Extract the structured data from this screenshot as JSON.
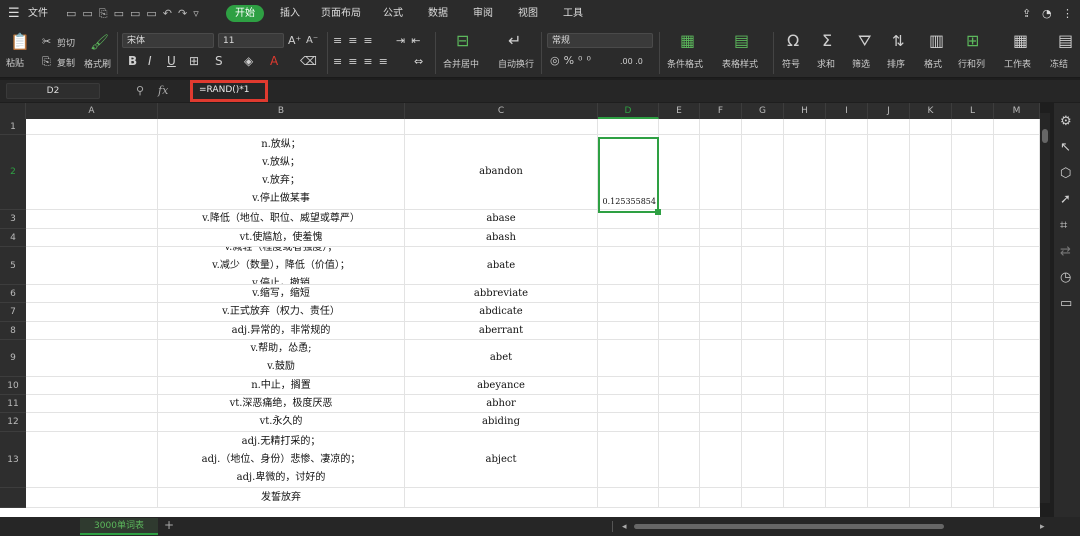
{
  "menubar": {
    "file": "文件",
    "tabs": [
      "开始",
      "插入",
      "页面布局",
      "公式",
      "数据",
      "审阅",
      "视图",
      "工具"
    ],
    "active_tab": "开始",
    "accent": "#2ea043"
  },
  "ribbon": {
    "cut": "剪切",
    "paste": "粘贴",
    "copy": "复制",
    "format_painter": "格式刷",
    "font_name": "宋体",
    "font_size": "11",
    "merge_center": "合并居中",
    "wrap_text": "自动换行",
    "number_format": "常规",
    "conditional_format": "条件格式",
    "table_style": "表格样式",
    "symbol": "符号",
    "sum": "求和",
    "filter": "筛选",
    "sort": "排序",
    "format": "格式",
    "row_col": "行和列",
    "worksheet": "工作表",
    "freeze": "冻结"
  },
  "formula_bar": {
    "cell_ref": "D2",
    "fx": "fx",
    "formula": "=RAND()*1",
    "highlight_color": "#e03a2f"
  },
  "columns": [
    "A",
    "B",
    "C",
    "D",
    "E",
    "F",
    "G",
    "H",
    "I",
    "J",
    "K",
    "L",
    "M"
  ],
  "active_column": "D",
  "rows": [
    {
      "num": "1",
      "b": [],
      "c": "",
      "d": ""
    },
    {
      "num": "2",
      "b": [
        "n.放纵；",
        "v.放纵；",
        "v.放弃；",
        "v.停止做某事"
      ],
      "c": "abandon",
      "d": "0.125355854"
    },
    {
      "num": "3",
      "b": [
        "v.降低（地位、职位、威望或尊严）"
      ],
      "c": "abase",
      "d": ""
    },
    {
      "num": "4",
      "b": [
        "vt.使尴尬，使羞愧"
      ],
      "c": "abash",
      "d": ""
    },
    {
      "num": "5",
      "b": [
        "v.减轻（程度或者强度）；",
        "v.减少（数量），降低（价值）；",
        "v.停止，撤销"
      ],
      "c": "abate",
      "d": ""
    },
    {
      "num": "6",
      "b": [
        "v.缩写，缩短"
      ],
      "c": "abbreviate",
      "d": ""
    },
    {
      "num": "7",
      "b": [
        "v.正式放弃（权力、责任）"
      ],
      "c": "abdicate",
      "d": ""
    },
    {
      "num": "8",
      "b": [
        "adj.异常的，非常规的"
      ],
      "c": "aberrant",
      "d": ""
    },
    {
      "num": "9",
      "b": [
        "v.帮助，怂恿;",
        "v.鼓励"
      ],
      "c": "abet",
      "d": ""
    },
    {
      "num": "10",
      "b": [
        "n.中止，搁置"
      ],
      "c": "abeyance",
      "d": ""
    },
    {
      "num": "11",
      "b": [
        "vt.深恶痛绝，极度厌恶"
      ],
      "c": "abhor",
      "d": ""
    },
    {
      "num": "12",
      "b": [
        "vt.永久的"
      ],
      "c": "abiding",
      "d": ""
    },
    {
      "num": "13",
      "b": [
        "adj.无精打采的；",
        "adj.（地位、身份）悲惨、凄凉的；",
        "adj.卑微的，讨好的"
      ],
      "c": "abject",
      "d": ""
    },
    {
      "num": "",
      "b": [
        "发誓放弃"
      ],
      "c": "",
      "d": ""
    }
  ],
  "sheet_tab": "3000单词表",
  "add_sheet": "+"
}
